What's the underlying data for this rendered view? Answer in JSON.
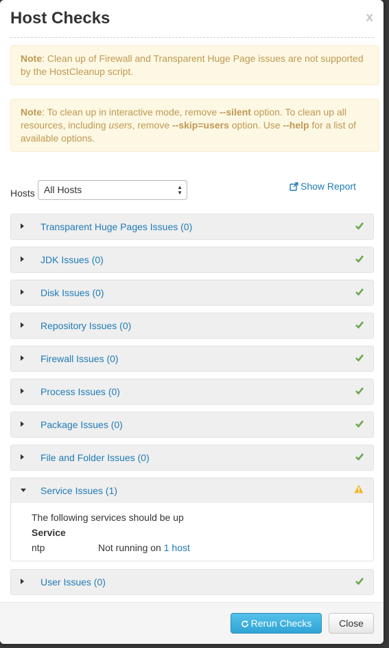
{
  "modal": {
    "title": "Host Checks",
    "close_glyph": "x"
  },
  "alerts": [
    {
      "note_label": "Note",
      "text": ": Clean up of Firewall and Transparent Huge Page issues are not supported by the HostCleanup script."
    },
    {
      "note_label": "Note",
      "p1": ": To clean up in interactive mode, remove ",
      "silent": "--silent",
      "p2": " option. To clean up all resources, including ",
      "users": "users",
      "p3": ", remove ",
      "skip": "--skip=users",
      "p4": " option. Use ",
      "help": "--help",
      "p5": " for a list of available options."
    }
  ],
  "hosts_filter": {
    "label": "Hosts",
    "selected": "All Hosts"
  },
  "show_report": {
    "label": "Show Report",
    "icon": "external-link-icon"
  },
  "panels": [
    {
      "title": "Transparent Huge Pages Issues (0)",
      "status": "ok"
    },
    {
      "title": "JDK Issues (0)",
      "status": "ok"
    },
    {
      "title": "Disk Issues (0)",
      "status": "ok"
    },
    {
      "title": "Repository Issues (0)",
      "status": "ok"
    },
    {
      "title": "Firewall Issues (0)",
      "status": "ok"
    },
    {
      "title": "Process Issues (0)",
      "status": "ok"
    },
    {
      "title": "Package Issues (0)",
      "status": "ok"
    },
    {
      "title": "File and Folder Issues (0)",
      "status": "ok"
    },
    {
      "title": "Service Issues (1)",
      "status": "warning",
      "expanded": true,
      "body": {
        "message": "The following services should be up",
        "column_header": "Service",
        "rows": [
          {
            "service": "ntp",
            "status_text": "Not running on ",
            "link": "1 host"
          }
        ]
      }
    },
    {
      "title": "User Issues (0)",
      "status": "ok"
    }
  ],
  "footer": {
    "rerun_label": "Rerun Checks",
    "close_label": "Close"
  },
  "colors": {
    "link": "#1f7bb6",
    "ok": "#6aa84f",
    "warning": "#f0b429",
    "alert_bg": "#fcf8e3",
    "alert_text": "#c09853"
  }
}
